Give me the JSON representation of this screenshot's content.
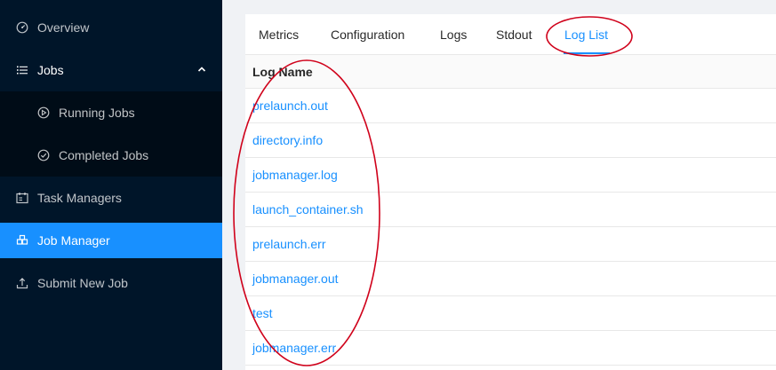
{
  "sidebar": {
    "items": [
      {
        "label": "Overview",
        "icon": "dashboard-icon"
      },
      {
        "label": "Jobs",
        "icon": "list-icon",
        "expanded": true
      },
      {
        "label": "Running Jobs",
        "icon": "play-circle-icon"
      },
      {
        "label": "Completed Jobs",
        "icon": "check-circle-icon"
      },
      {
        "label": "Task Managers",
        "icon": "schedule-icon"
      },
      {
        "label": "Job Manager",
        "icon": "build-icon",
        "active": true
      },
      {
        "label": "Submit New Job",
        "icon": "upload-icon"
      }
    ]
  },
  "tabs": [
    {
      "label": "Metrics"
    },
    {
      "label": "Configuration"
    },
    {
      "label": "Logs"
    },
    {
      "label": "Stdout"
    },
    {
      "label": "Log List",
      "active": true
    }
  ],
  "table": {
    "header": "Log Name",
    "rows": [
      "prelaunch.out",
      "directory.info",
      "jobmanager.log",
      "launch_container.sh",
      "prelaunch.err",
      "jobmanager.out",
      "test",
      "jobmanager.err"
    ]
  },
  "colors": {
    "sidebar_bg": "#001529",
    "submenu_bg": "#000c17",
    "accent": "#1890ff",
    "annotation": "#d0021b"
  }
}
